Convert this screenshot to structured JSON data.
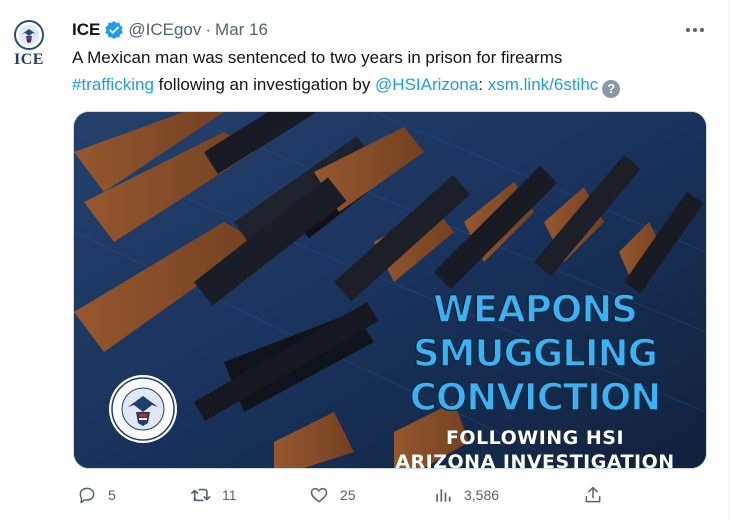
{
  "tweet": {
    "author_name": "ICE",
    "handle": "@ICEgov",
    "separator": "·",
    "date": "Mar 16",
    "avatar_label": "ICE",
    "text_1": "A Mexican man was sentenced to two years in prison for firearms",
    "hashtag": "#trafficking",
    "text_2": " following an investigation by ",
    "mention": "@HSIArizona",
    "text_3": ": ",
    "link": "xsm.link/6stihc",
    "help_glyph": "?"
  },
  "media": {
    "headline": [
      "WEAPONS",
      "SMUGGLING",
      "CONVICTION"
    ],
    "sub": [
      "FOLLOWING HSI",
      "ARIZONA INVESTIGATION"
    ],
    "seal_text_top": "U.S. DEPARTMENT OF",
    "seal_text_bottom": "HOMELAND SECURITY"
  },
  "actions": {
    "replies": "5",
    "reposts": "11",
    "likes": "25",
    "views": "3,586"
  },
  "colors": {
    "link": "#1d9bf0",
    "text": "#0f1419",
    "muted": "#536471",
    "verified": "#1d9bf0",
    "headline": "#3fb1f2"
  },
  "icons": [
    "verified-badge-icon",
    "more-icon",
    "help-icon",
    "reply-icon",
    "repost-icon",
    "like-icon",
    "views-icon",
    "share-icon"
  ]
}
